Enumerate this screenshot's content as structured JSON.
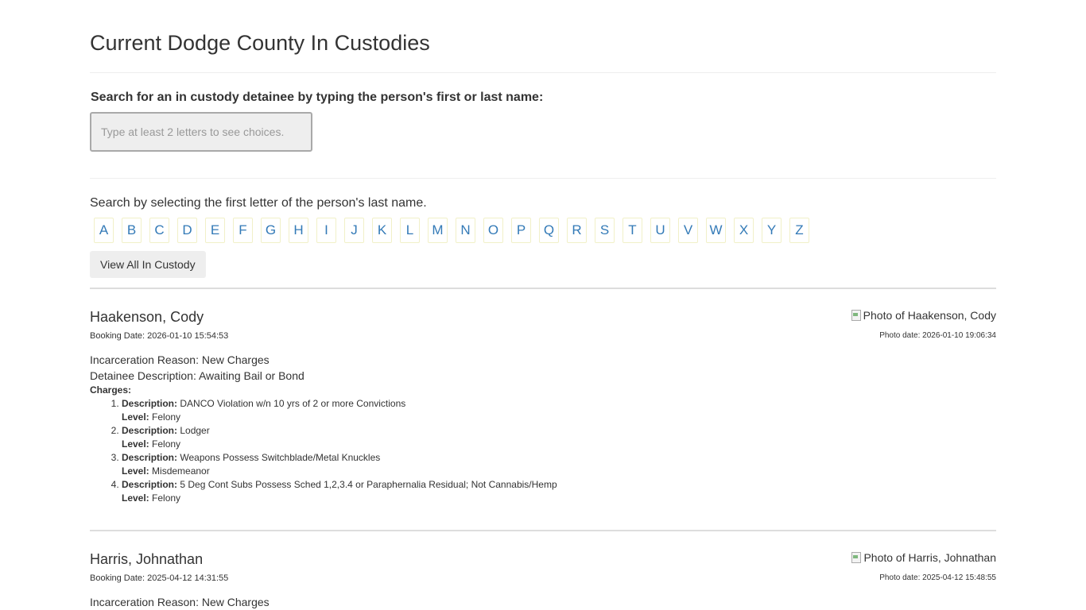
{
  "page": {
    "title": "Current Dodge County In Custodies"
  },
  "search": {
    "label": "Search for an in custody detainee by typing the person's first or last name:",
    "placeholder": "Type at least 2 letters to see choices."
  },
  "letter_search": {
    "label": "Search by selecting the first letter of the person's last name.",
    "letters": [
      "A",
      "B",
      "C",
      "D",
      "E",
      "F",
      "G",
      "H",
      "I",
      "J",
      "K",
      "L",
      "M",
      "N",
      "O",
      "P",
      "Q",
      "R",
      "S",
      "T",
      "U",
      "V",
      "W",
      "X",
      "Y",
      "Z"
    ]
  },
  "view_all_label": "View All In Custody",
  "field_labels": {
    "description": "Description:",
    "level": "Level:",
    "charges": "Charges:"
  },
  "detainees": [
    {
      "name": "Haakenson, Cody",
      "photo_alt": "Photo of Haakenson, Cody",
      "booking_date": "Booking Date: 2026-01-10 15:54:53",
      "photo_date": "Photo date: 2026-01-10 19:06:34",
      "incarceration_reason": "Incarceration Reason: New Charges",
      "detainee_description": "Detainee Description: Awaiting Bail or Bond",
      "charges": [
        {
          "description": "DANCO Violation w/n 10 yrs of 2 or more Convictions",
          "level": "Felony"
        },
        {
          "description": "Lodger",
          "level": "Felony"
        },
        {
          "description": "Weapons Possess Switchblade/Metal Knuckles",
          "level": "Misdemeanor"
        },
        {
          "description": "5 Deg Cont Subs Possess Sched 1,2,3.4 or Paraphernalia Residual; Not Cannabis/Hemp",
          "level": "Felony"
        }
      ]
    },
    {
      "name": "Harris, Johnathan",
      "photo_alt": "Photo of Harris, Johnathan",
      "booking_date": "Booking Date: 2025-04-12 14:31:55",
      "photo_date": "Photo date: 2025-04-12 15:48:55",
      "incarceration_reason": "Incarceration Reason: New Charges"
    }
  ]
}
